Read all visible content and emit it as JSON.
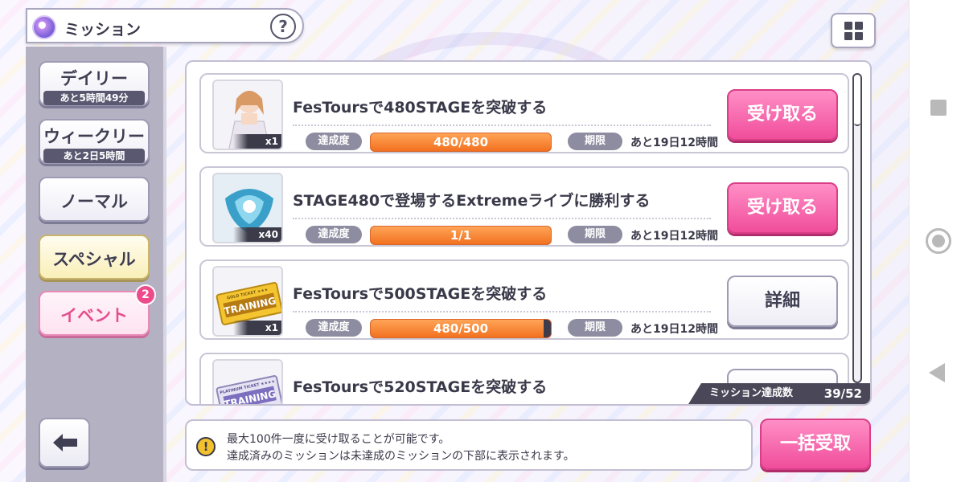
{
  "header": {
    "title": "ミッション",
    "help_label": "?"
  },
  "sidebar": {
    "tabs": [
      {
        "label": "デイリー",
        "sub": "あと5時間49分"
      },
      {
        "label": "ウィークリー",
        "sub": "あと2日5時間"
      },
      {
        "label": "ノーマル"
      },
      {
        "label": "スペシャル"
      },
      {
        "label": "イベント",
        "badge": "2"
      }
    ]
  },
  "missions": {
    "progress_label": "達成度",
    "deadline_label": "期限",
    "items": [
      {
        "title": "FesToursで480STAGEを突破する",
        "qty": "x1",
        "progress": "480/480",
        "progress_fraction": 1.0,
        "deadline": "あと19日12時間",
        "action": "受け取る",
        "reward_icon": "card-character-icon"
      },
      {
        "title": "STAGE480で登場するExtremeライブに勝利する",
        "qty": "x40",
        "progress": "1/1",
        "progress_fraction": 1.0,
        "deadline": "あと19日12時間",
        "action": "受け取る",
        "reward_icon": "crystal-icon"
      },
      {
        "title": "FesToursで500STAGEを突破する",
        "qty": "x1",
        "progress": "480/500",
        "progress_fraction": 0.96,
        "deadline": "あと19日12時間",
        "action": "詳細",
        "reward_icon": "training-ticket-icon",
        "ticket_text": "TRAINING",
        "ticket_header": "GOLD TICKET ★★★"
      },
      {
        "title": "FesToursで520STAGEを突破する",
        "reward_icon": "training-ticket-icon",
        "ticket_text": "TRAINING",
        "ticket_header": "PLATINUM TICKET ★★★★"
      }
    ],
    "summary_label": "ミッション達成数",
    "summary_value": "39/52"
  },
  "info": {
    "line1": "最大100件一度に受け取ることが可能です。",
    "line2": "達成済みのミッションは未達成のミッションの下部に表示されます。",
    "warn_icon": "!"
  },
  "bulk_button": "一括受取",
  "colors": {
    "accent_pink": "#f04d9b",
    "progress_orange": "#f27120",
    "panel_border": "#c2bfd2"
  }
}
